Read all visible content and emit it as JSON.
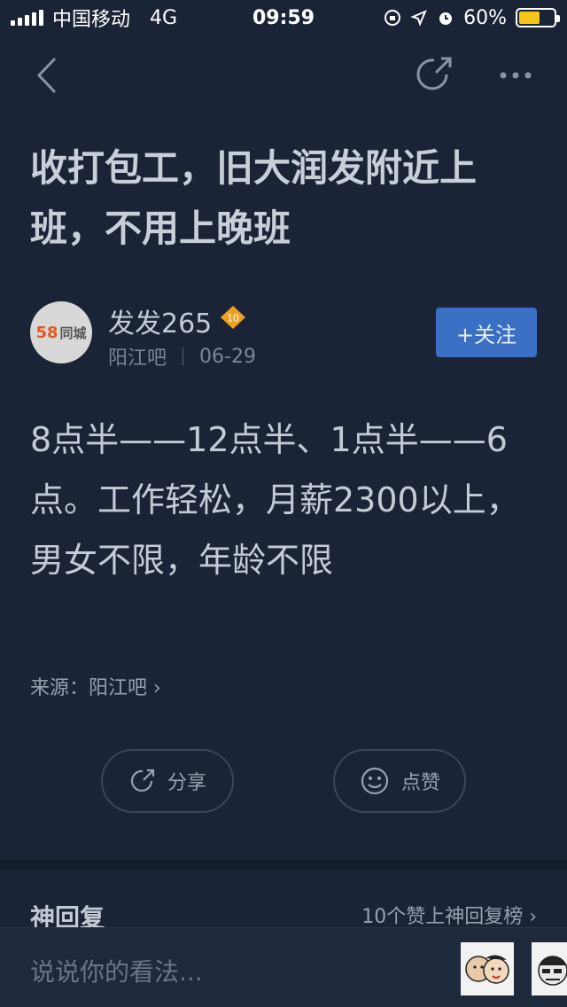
{
  "status_bar": {
    "carrier": "中国移动",
    "network": "4G",
    "time": "09:59",
    "battery": "60%",
    "battery_level": 0.6
  },
  "nav": {
    "back_icon": "back-chevron-icon",
    "share_icon": "share-icon",
    "more_icon": "more-icon"
  },
  "post": {
    "title": "收打包工，旧大润发附近上班，不用上晚班",
    "author": {
      "name": "发发265",
      "level": "10",
      "avatar_text_number": "58",
      "avatar_text_brand": "同城",
      "forum": "阳江吧",
      "date": "06-29"
    },
    "follow_label": "+关注",
    "content": "8点半——12点半、1点半——6点。工作轻松，月薪2300以上，男女不限，年龄不限",
    "source": "来源：阳江吧 ›"
  },
  "actions": {
    "share_label": "分享",
    "like_label": "点赞"
  },
  "god_reply": {
    "title": "神回复",
    "link": "10个赞上神回复榜 ›"
  },
  "comment": {
    "placeholder": "说说你的看法..."
  },
  "colors": {
    "background": "#1b2437",
    "accent": "#3a6fc4",
    "battery": "#f5c518",
    "badge": "#f0a020"
  }
}
